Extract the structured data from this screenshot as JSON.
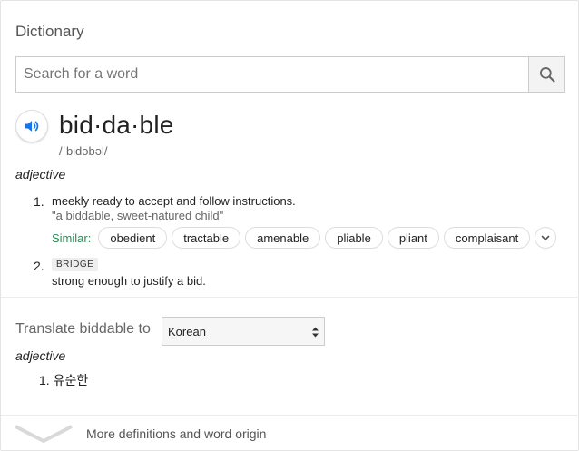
{
  "header": {
    "title": "Dictionary"
  },
  "search": {
    "placeholder": "Search for a word",
    "value": ""
  },
  "entry": {
    "headword": "bid·da·ble",
    "phonetic": "/ˈbidəbəl/",
    "part_of_speech": "adjective",
    "senses": [
      {
        "number": "1.",
        "definition": "meekly ready to accept and follow instructions.",
        "example": "\"a biddable, sweet-natured child\"",
        "similar_label": "Similar:",
        "similar": [
          "obedient",
          "tractable",
          "amenable",
          "pliable",
          "pliant",
          "complaisant"
        ]
      },
      {
        "number": "2.",
        "label": "BRIDGE",
        "definition": "strong enough to justify a bid."
      }
    ]
  },
  "translate": {
    "label": "Translate biddable to",
    "language": "Korean",
    "part_of_speech": "adjective",
    "items": [
      {
        "number": "1.",
        "text": "유순한"
      }
    ]
  },
  "footer": {
    "more_label": "More definitions and word origin"
  },
  "colors": {
    "accent_blue": "#1a73e8",
    "similar_green": "#2e8b57"
  }
}
